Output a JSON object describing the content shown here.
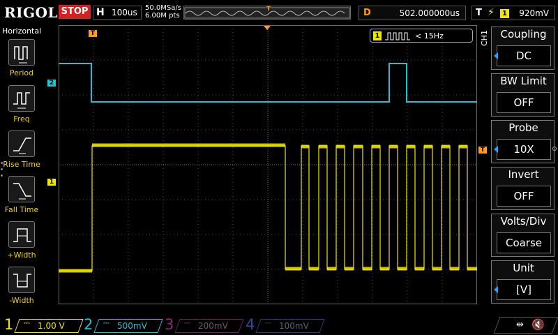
{
  "brand": "RIGOL",
  "run_state": "STOP",
  "horizontal": {
    "label": "H",
    "timebase": "100us",
    "sample_rate": "50.0MSa/s",
    "memory_depth": "6.00M pts"
  },
  "delay": {
    "label": "D",
    "value": "502.000000us"
  },
  "trigger": {
    "label": "T",
    "edge_icon": "rising-edge-icon",
    "source": "1",
    "level": "920mV"
  },
  "sidebar": {
    "title": "Horizontal",
    "items": [
      {
        "label": "Period",
        "icon": "period-icon"
      },
      {
        "label": "Freq",
        "icon": "frequency-icon"
      },
      {
        "label": "Rise Time",
        "icon": "rise-time-icon"
      },
      {
        "label": "Fall Time",
        "icon": "fall-time-icon"
      },
      {
        "label": "+Width",
        "icon": "positive-width-icon"
      },
      {
        "label": "-Width",
        "icon": "negative-width-icon"
      }
    ]
  },
  "frequency_counter": {
    "channel": "1",
    "text": "< 15Hz"
  },
  "menu": {
    "channel_tag": "CH1",
    "items": [
      {
        "title": "Coupling",
        "value": "DC"
      },
      {
        "title": "BW Limit",
        "value": "OFF"
      },
      {
        "title": "Probe",
        "value": "10X"
      },
      {
        "title": "Invert",
        "value": "OFF"
      },
      {
        "title": "Volts/Div",
        "value": "Coarse"
      },
      {
        "title": "Unit",
        "value": "[V]"
      }
    ]
  },
  "channels": [
    {
      "number": "1",
      "scale": "1.00 V",
      "color": "#f2e600"
    },
    {
      "number": "2",
      "scale": "500mV",
      "color": "#1fc4d4"
    },
    {
      "number": "3",
      "scale": "200mV",
      "color": "#c02a9a"
    },
    {
      "number": "4",
      "scale": "100mV",
      "color": "#2a59c8"
    }
  ],
  "markers": {
    "ch1": "1",
    "ch2": "2",
    "trigger_pos": "T",
    "trigger_level": "T"
  },
  "colors": {
    "ch1": "#f2e600",
    "ch2": "#1fc4d4",
    "trigger": "#ff9a1a",
    "menu_accent": "#1aa6ff"
  }
}
